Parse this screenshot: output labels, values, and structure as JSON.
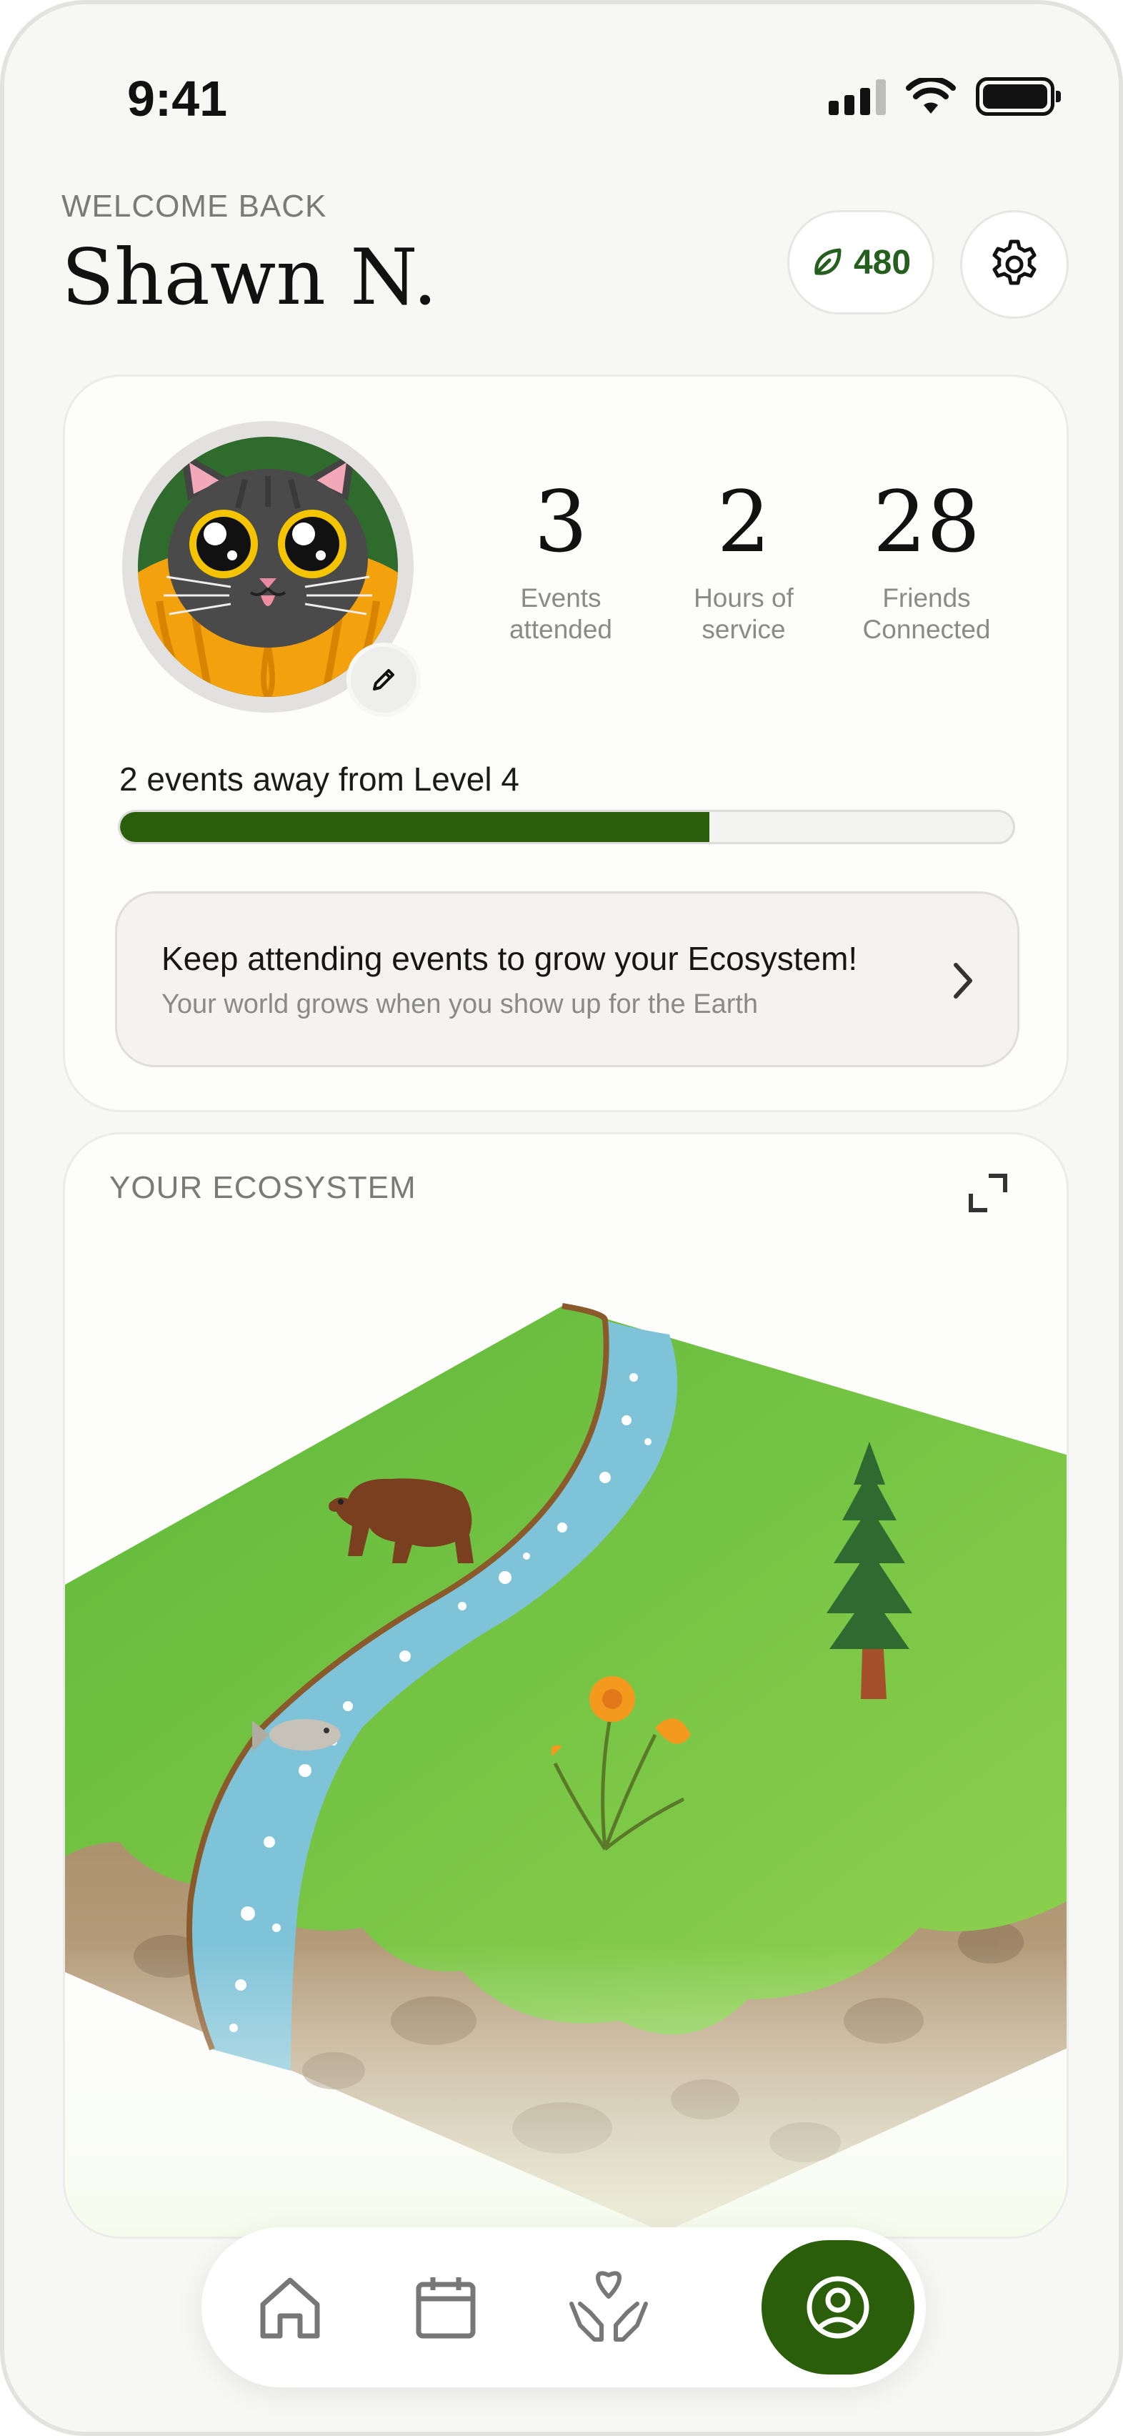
{
  "status_bar": {
    "time": "9:41"
  },
  "header": {
    "welcome": "WELCOME BACK",
    "username": "Shawn N.",
    "points": "480",
    "points_icon": "leaf-icon",
    "settings_icon": "gear-icon"
  },
  "profile": {
    "avatar": "cat-avatar",
    "stats": [
      {
        "value": "3",
        "label_line1": "Events",
        "label_line2": "attended"
      },
      {
        "value": "2",
        "label_line1": "Hours of",
        "label_line2": "service"
      },
      {
        "value": "28",
        "label_line1": "Friends",
        "label_line2": "Connected"
      }
    ],
    "level_text": "2 events away from Level 4",
    "level_progress": 0.66,
    "tip": {
      "title": "Keep attending events to grow your Ecosystem!",
      "subtitle": "Your world grows when you show up for the Earth"
    }
  },
  "ecosystem": {
    "title": "YOUR ECOSYSTEM",
    "elements": [
      "bear",
      "river",
      "fish",
      "poppy-flowers",
      "redwood-tree"
    ]
  },
  "nav": {
    "items": [
      "home-icon",
      "calendar-icon",
      "heart-hands-icon",
      "profile-icon"
    ],
    "active": "profile-icon"
  },
  "colors": {
    "accent_green": "#2a5e0a",
    "points_green": "#245f1d",
    "background": "#f7f7f6"
  }
}
